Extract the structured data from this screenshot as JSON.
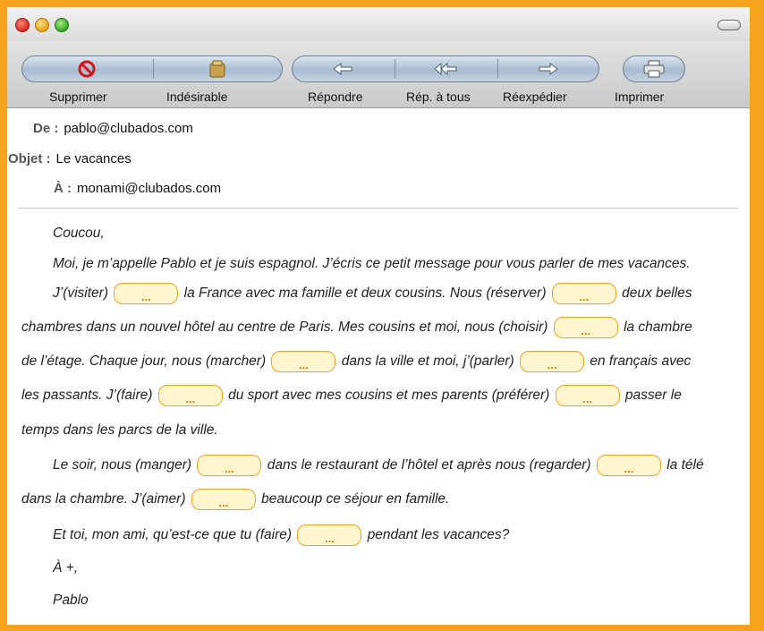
{
  "toolbar": {
    "delete_label": "Supprimer",
    "junk_label": "Indésirable",
    "reply_label": "Répondre",
    "reply_all_label": "Rép. à tous",
    "forward_label": "Réexpédier",
    "print_label": "Imprimer"
  },
  "headers": {
    "from_key": "De :",
    "from_value": "pablo@clubados.com",
    "subject_key": "Objet :",
    "subject_value": "Le vacances",
    "to_key": "À :",
    "to_value": "monami@clubados.com"
  },
  "message": {
    "greeting": "Coucou,",
    "p1": "Moi, je m’appelle Pablo et je suis espagnol. J’écris ce petit message pour vous parler de mes vacances.",
    "s1": "J’(visiter)",
    "s2": "la France avec ma famille et deux cousins. Nous (réserver)",
    "s3": "deux belles",
    "s4": "chambres dans un nouvel hôtel au centre de Paris. Mes cousins et moi, nous (choisir)",
    "s5": "la chambre",
    "s6": "de l’étage. Chaque jour, nous (marcher)",
    "s7": "dans la ville et moi, j’(parler)",
    "s8": "en français avec",
    "s9": "les passants. J’(faire)",
    "s10": "du sport avec mes cousins et mes parents (préférer)",
    "s11": "passer le",
    "s12": "temps dans les parcs de la ville.",
    "s13": "Le soir, nous (manger)",
    "s14": "dans le restaurant de l’hôtel et après nous (regarder)",
    "s15": "la télé",
    "s16": "dans la chambre. J’(aimer)",
    "s17": "beaucoup ce séjour en famille.",
    "s18": "Et toi, mon ami, qu’est-ce que tu (faire)",
    "s19": "pendant les vacances?",
    "closing": "À +,",
    "signature": "Pablo",
    "blank_text": "..."
  }
}
